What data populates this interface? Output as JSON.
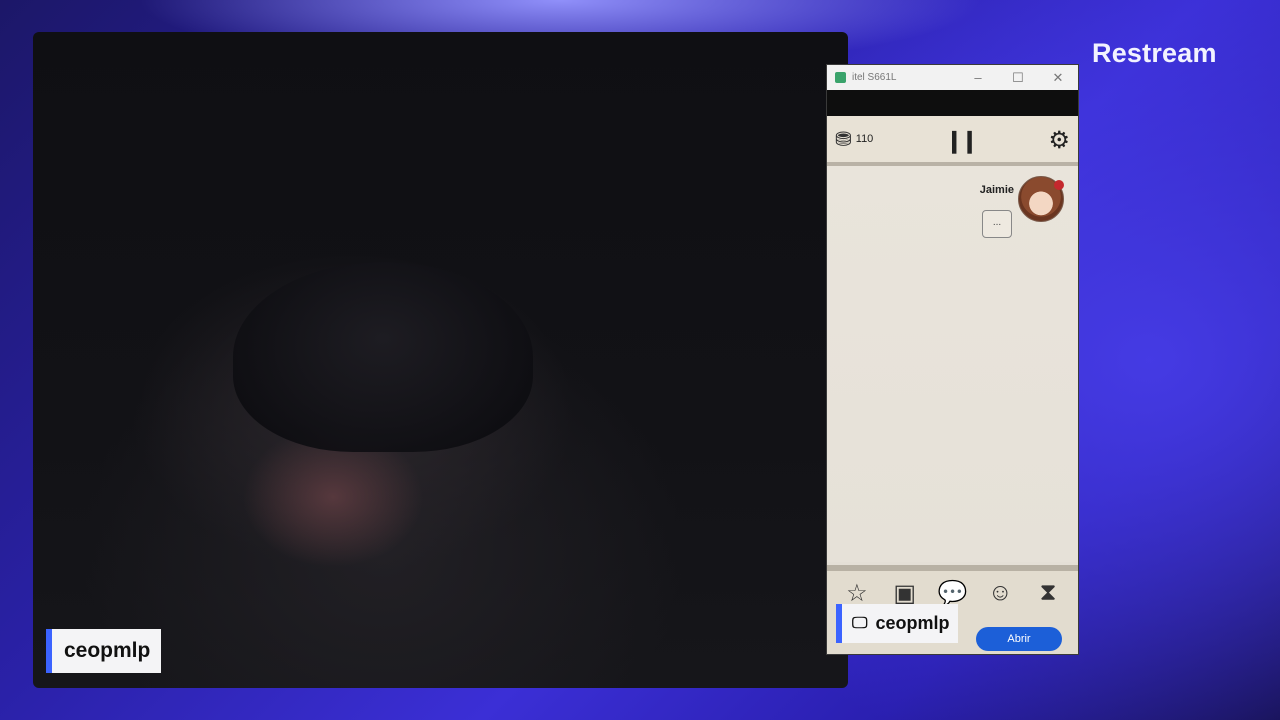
{
  "brand": {
    "label": "Restream"
  },
  "camera": {
    "name_tag": "ceopmlp"
  },
  "phone": {
    "window_title": "itel S661L",
    "window_controls": {
      "minimize": "–",
      "maximize": "☐",
      "close": "✕"
    },
    "game": {
      "coin_count": "110",
      "chat": {
        "sender": "Jaimie",
        "bubble": "..."
      },
      "ad_button": "Abrir"
    }
  },
  "screen_share": {
    "name_tag": "ceopmlp"
  },
  "colors": {
    "accent": "#3b63ff",
    "background": "#2a21a8",
    "ad_button": "#1c5fd8"
  }
}
